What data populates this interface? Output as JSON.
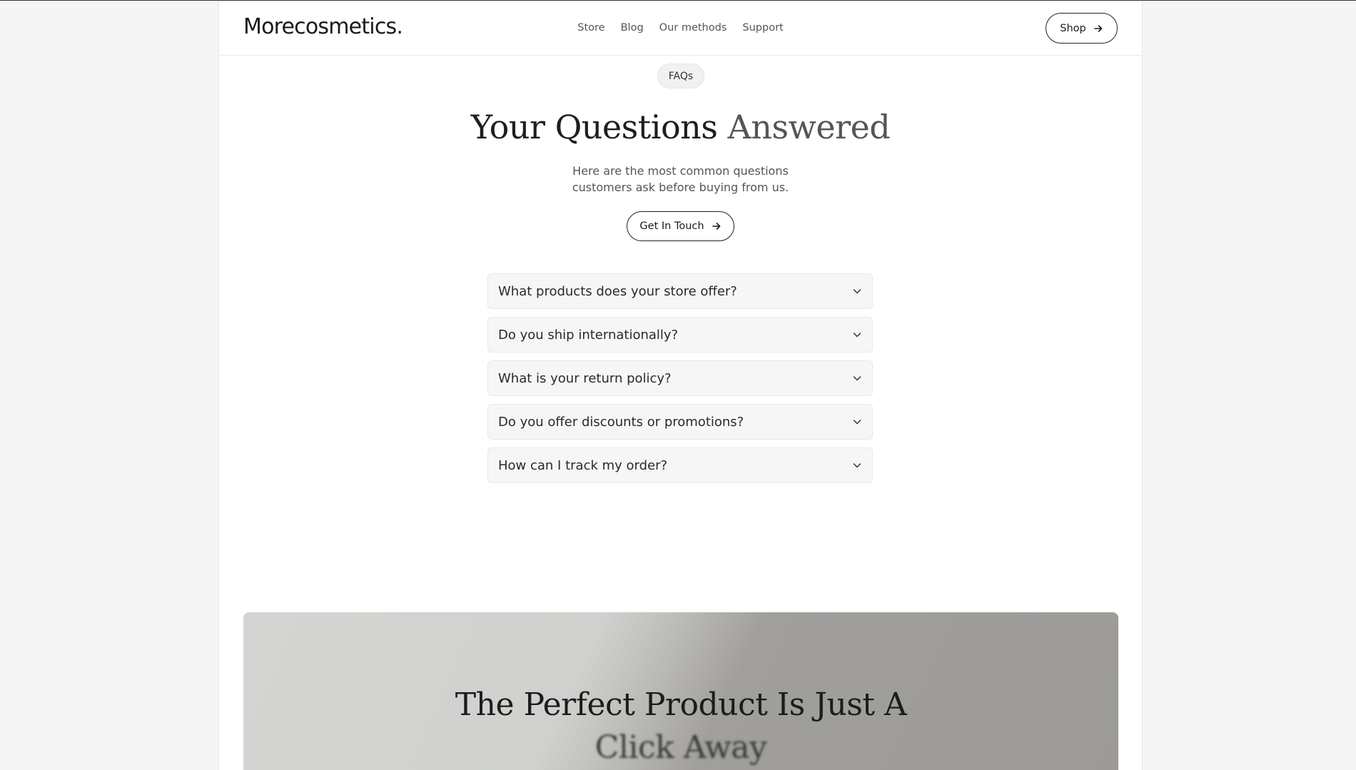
{
  "header": {
    "logo": "Morecosmetics.",
    "nav": [
      "Store",
      "Blog",
      "Our methods",
      "Support"
    ],
    "shop_label": "Shop"
  },
  "hero": {
    "badge": "FAQs",
    "title_main": "Your Questions",
    "title_accent": "Answered",
    "subtitle_line1": "Here are the most common questions",
    "subtitle_line2": "customers ask before buying from us.",
    "cta_label": "Get In Touch"
  },
  "faqs": [
    "What products does your store offer?",
    "Do you ship internationally?",
    "What is your return policy?",
    "Do you offer discounts or promotions?",
    "How can I track my order?"
  ],
  "banner": {
    "title_line1": "The Perfect Product Is Just A",
    "title_line2": "Click Away"
  }
}
